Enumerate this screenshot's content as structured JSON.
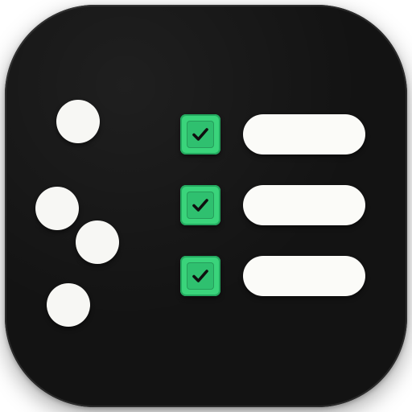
{
  "icon": {
    "name": "checklist-app-icon",
    "tile_color": "#131313",
    "accent_color": "#3ad47b",
    "foreground_color": "#f7f7f4",
    "dots": [
      {
        "name": "dot-1"
      },
      {
        "name": "dot-2"
      },
      {
        "name": "dot-3"
      },
      {
        "name": "dot-4"
      }
    ],
    "rows": [
      {
        "checkbox": "checked",
        "icon": "checkmark-icon"
      },
      {
        "checkbox": "checked",
        "icon": "checkmark-icon"
      },
      {
        "checkbox": "checked",
        "icon": "checkmark-icon"
      }
    ]
  }
}
